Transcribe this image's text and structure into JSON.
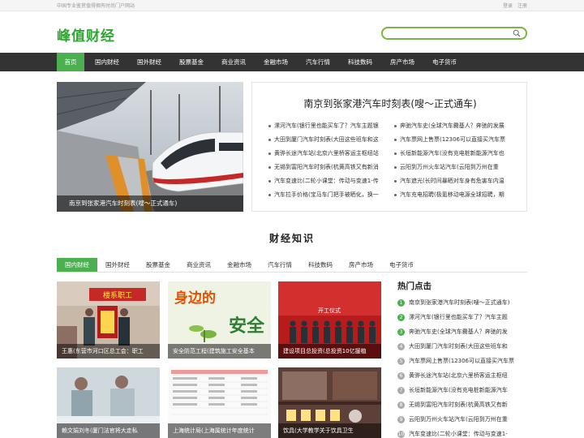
{
  "topbar": {
    "tagline": "中国专业鉴赏值得拥有时尚门户网站",
    "login": "登录",
    "register": "注册"
  },
  "header": {
    "logo": "峰值财经",
    "search_placeholder": ""
  },
  "nav": {
    "items": [
      "首页",
      "国内财经",
      "国外财经",
      "股票基金",
      "商业资讯",
      "金融市场",
      "汽车行情",
      "科技数码",
      "房产市场",
      "电子货币"
    ]
  },
  "hero": {
    "caption": "南京到张家港汽车时刻表(嗖～正式通车)",
    "title": "南京到张家港汽车时刻表(嗖～正式通车)",
    "links": [
      "漯河汽车(银行里也能买车了？汽车主题银",
      "奔驰汽车史(全球汽车爨基人？奔驰的发展",
      "大田到厦门汽车时刻表(大田这些班车和这",
      "汽车票网上售票(12306可以直接买汽车票",
      "黄骅长途汽车站(北京六里桥客运主枢纽站",
      "长垣新能源汽车(没有充电桩新能源汽车也",
      "无锡到富阳汽车时刻表(杭黄高铁又有新消",
      "云阳到万州火车站汽车(云阳到万州在重",
      "汽车变速比(二轮小课堂：传动与变速1-传",
      "汽车遮光(长时间暴晒对车身有危害车内温",
      "汽车拉手价格(宝马车门把手被晒化，换一",
      "汽车充电招聘(极氪移动电源全球招聘，期"
    ]
  },
  "section": {
    "title": "财经知识",
    "tabs": [
      "国内财经",
      "国外财经",
      "股票基金",
      "商业资讯",
      "金融市场",
      "汽车行情",
      "科技数码",
      "房产市场",
      "电子货币"
    ]
  },
  "cards": [
    {
      "caption": "王惠(东营市河口区总工会：职工"
    },
    {
      "caption": "安全防范工程(建筑施工安全基本"
    },
    {
      "caption": "建设项目总投资(总投资10亿援植"
    },
    {
      "caption": "赖文娟刘冬(厦门法官将大走私"
    },
    {
      "caption": "上海统计局(上海属统计年度统计"
    },
    {
      "caption": "饮具(大学教学关于饮具卫生"
    }
  ],
  "card_images": {
    "img2_text1": "身边的",
    "img2_text2": "安全",
    "img1_banner": "楼系职工",
    "img3_banner": "开工仪式"
  },
  "hot": {
    "title": "热门点击",
    "items": [
      "南京到张家港汽车时刻表(嗖～正式通车)",
      "漯河汽车(银行里也能买车了？汽车主题",
      "奔驰汽车史(全球汽车爨基人？奔驰的发",
      "大田到厦门汽车时刻表(大田这些班车和",
      "汽车票网上售票(12306可以直接买汽车票",
      "黄骅长途汽车站(北京六里桥客运主枢纽",
      "长垣新能源汽车(没有充电桩新能源汽车",
      "无锡到富阳汽车时刻表(杭黄高铁又有新",
      "云阳到万州火车站汽车(云阳到万州在重",
      "汽车变速比(二轮小课堂：传动与变速1-"
    ]
  },
  "colors": {
    "accent": "#4caf50",
    "nav_bg": "#333333",
    "logo": "#2fa534"
  }
}
